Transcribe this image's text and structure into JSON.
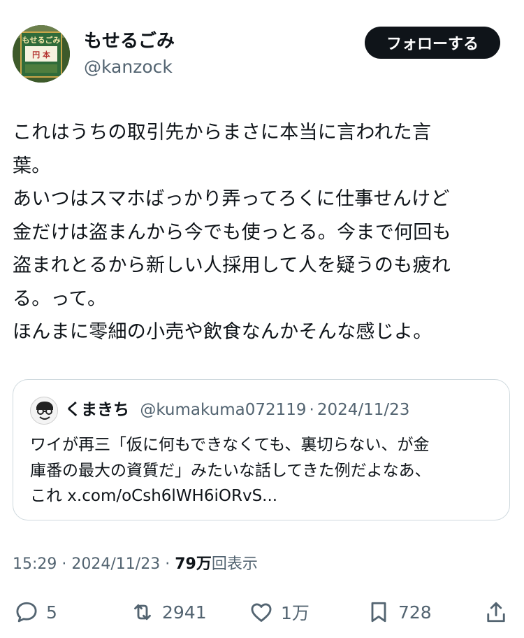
{
  "author": {
    "display_name": "もせるごみ",
    "handle": "@kanzock",
    "avatar_sign_text": "もせるごみ",
    "avatar_sign_sub": "円 本"
  },
  "follow_button_label": "フォローする",
  "tweet": {
    "lines": [
      "これはうちの取引先からまさに本当に言われた言",
      "葉。",
      "あいつはスマホばっかり弄ってろくに仕事せんけど",
      "金だけは盗まんから今でも使っとる。今まで何回も",
      "盗まれとるから新しい人採用して人を疑うのも疲れ",
      "る。って。",
      "ほんまに零細の小売や飲食なんかそんな感じよ。"
    ]
  },
  "quoted": {
    "display_name": "くまきち",
    "handle": "@kumakuma072119",
    "separator": "·",
    "date": "2024/11/23",
    "lines": [
      "ワイが再三「仮に何もできなくても、裏切らない、が金",
      "庫番の最大の資質だ」みたいな話してきた例だよなあ、",
      "これ x.com/oCsh6lWH6iORvS..."
    ]
  },
  "meta": {
    "time": "15:29",
    "sep1": "·",
    "date": "2024/11/23",
    "sep2": "·",
    "views_count": "79万",
    "views_label": "回表示"
  },
  "actions": {
    "replies": "5",
    "reposts": "2941",
    "likes": "1万",
    "bookmarks": "728"
  },
  "colors": {
    "text": "#0f1419",
    "secondary": "#536471",
    "border": "#cfd9de",
    "button_bg": "#0f1419"
  }
}
